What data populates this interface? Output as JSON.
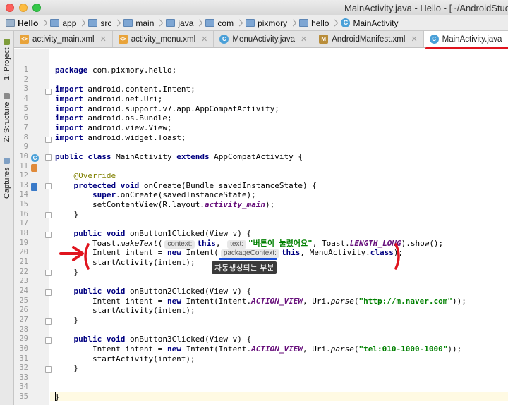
{
  "window": {
    "title": "MainActivity.java - Hello - [~/AndroidStudi"
  },
  "breadcrumb": [
    {
      "label": "Hello",
      "icon": "module-icon",
      "bold": true
    },
    {
      "label": "app",
      "icon": "folder-icon"
    },
    {
      "label": "src",
      "icon": "folder-icon"
    },
    {
      "label": "main",
      "icon": "folder-icon"
    },
    {
      "label": "java",
      "icon": "folder-icon"
    },
    {
      "label": "com",
      "icon": "folder-icon"
    },
    {
      "label": "pixmory",
      "icon": "folder-icon"
    },
    {
      "label": "hello",
      "icon": "folder-icon"
    },
    {
      "label": "MainActivity",
      "icon": "class-icon"
    }
  ],
  "tabs": [
    {
      "label": "activity_main.xml",
      "type": "xml",
      "active": false
    },
    {
      "label": "activity_menu.xml",
      "type": "xml",
      "active": false
    },
    {
      "label": "MenuActivity.java",
      "type": "java",
      "active": false
    },
    {
      "label": "AndroidManifest.xml",
      "type": "manifest",
      "active": false
    },
    {
      "label": "MainActivity.java",
      "type": "java",
      "active": true
    }
  ],
  "tool_windows": [
    {
      "label": "1: Project"
    },
    {
      "label": "Z: Structure"
    },
    {
      "label": "Captures"
    }
  ],
  "editor": {
    "lines": [
      {
        "n": "1",
        "html": "<span class='kw'>package</span> com.pixmory.hello;"
      },
      {
        "n": "2",
        "html": ""
      },
      {
        "n": "3",
        "html": "<span class='kw'>import</span> android.content.Intent;"
      },
      {
        "n": "4",
        "html": "<span class='kw'>import</span> android.net.Uri;"
      },
      {
        "n": "5",
        "html": "<span class='kw'>import</span> android.support.v7.app.AppCompatActivity;"
      },
      {
        "n": "6",
        "html": "<span class='kw'>import</span> android.os.Bundle;"
      },
      {
        "n": "7",
        "html": "<span class='kw'>import</span> android.view.View;"
      },
      {
        "n": "8",
        "html": "<span class='kw'>import</span> android.widget.Toast;"
      },
      {
        "n": "9",
        "html": ""
      },
      {
        "n": "10",
        "html": "<span class='kw'>public class</span> MainActivity <span class='kw'>extends</span> AppCompatActivity {"
      },
      {
        "n": "11",
        "html": ""
      },
      {
        "n": "12",
        "html": "    <span class='ann'>@Override</span>"
      },
      {
        "n": "13",
        "html": "    <span class='kw'>protected void</span> onCreate(Bundle savedInstanceState) {"
      },
      {
        "n": "14",
        "html": "        <span class='kw'>super</span>.onCreate(savedInstanceState);"
      },
      {
        "n": "15",
        "html": "        setContentView(R.layout.<span class='fld'>activity_main</span>);"
      },
      {
        "n": "16",
        "html": "    }"
      },
      {
        "n": "17",
        "html": ""
      },
      {
        "n": "18",
        "html": "    <span class='kw'>public void</span> onButton1Clicked(View v) {"
      },
      {
        "n": "19",
        "html": "        Toast.<span class='it'>makeText</span>(<span class='hint'>context:</span><span class='kw'>this</span>, <span class='hint'>text:</span><span class='str'>\"버튼이 눌렸어요\"</span>, Toast.<span class='fld'>LENGTH_LONG</span>).show();"
      },
      {
        "n": "20",
        "html": "        Intent intent = <span class='kw'>new</span> Intent(<span class='hint'>packageContext:</span><span class='kw'>this</span>, MenuActivity.<span class='kw'>class</span>);"
      },
      {
        "n": "21",
        "html": "        startActivity(intent);"
      },
      {
        "n": "22",
        "html": "    }"
      },
      {
        "n": "23",
        "html": ""
      },
      {
        "n": "24",
        "html": "    <span class='kw'>public void</span> onButton2Clicked(View v) {"
      },
      {
        "n": "25",
        "html": "        Intent intent = <span class='kw'>new</span> Intent(Intent.<span class='fld'>ACTION_VIEW</span>, Uri.<span class='it'>parse</span>(<span class='str'>\"http://m.naver.com\"</span>));"
      },
      {
        "n": "26",
        "html": "        startActivity(intent);"
      },
      {
        "n": "27",
        "html": "    }"
      },
      {
        "n": "28",
        "html": ""
      },
      {
        "n": "29",
        "html": "    <span class='kw'>public void</span> onButton3Clicked(View v) {"
      },
      {
        "n": "30",
        "html": "        Intent intent = <span class='kw'>new</span> Intent(Intent.<span class='fld'>ACTION_VIEW</span>, Uri.<span class='it'>parse</span>(<span class='str'>\"tel:010-1000-1000\"</span>));"
      },
      {
        "n": "31",
        "html": "        startActivity(intent);"
      },
      {
        "n": "32",
        "html": "    }"
      },
      {
        "n": "33",
        "html": ""
      },
      {
        "n": "34",
        "html": ""
      },
      {
        "n": "35",
        "html": "}"
      }
    ]
  },
  "annotation": {
    "tooltip": "자동생성되는 부분",
    "accent_color": "#e0141e"
  }
}
